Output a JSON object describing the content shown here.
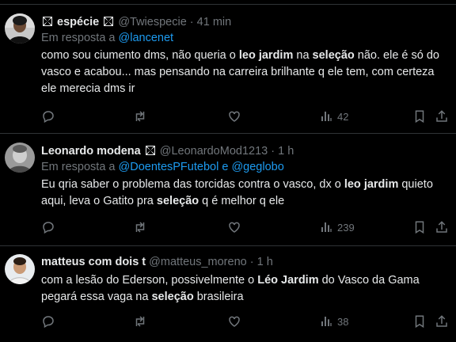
{
  "tweets": [
    {
      "display_name": "espécie",
      "handle": "@Twiespecie",
      "separator": "·",
      "time": "41 min",
      "reply_prefix": "Em resposta a",
      "reply_to": [
        "@lancenet"
      ],
      "reply_joiner": "",
      "text_segments": [
        {
          "t": "como sou ciumento dms, não queria o ",
          "b": false
        },
        {
          "t": "leo jardim",
          "b": true
        },
        {
          "t": " na ",
          "b": false
        },
        {
          "t": "seleção",
          "b": true
        },
        {
          "t": " não. ele é só do vasco e acabou... mas pensando na carreira brilhante q ele tem, com certeza ele merecia dms ir",
          "b": false
        }
      ],
      "views": "42",
      "icons": {
        "name_prefix": "maltese-cross-icon",
        "name_suffix": "maltese-cross-icon"
      }
    },
    {
      "display_name": "Leonardo modena",
      "handle": "@LeonardoMod1213",
      "separator": "·",
      "time": "1 h",
      "reply_prefix": "Em resposta a",
      "reply_to": [
        "@DoentesPFutebol",
        "@geglobo"
      ],
      "reply_joiner": "e",
      "text_segments": [
        {
          "t": "Eu qria saber o problema das torcidas contra o vasco, dx o ",
          "b": false
        },
        {
          "t": "leo jardim",
          "b": true
        },
        {
          "t": " quieto aqui, leva o Gatito pra ",
          "b": false
        },
        {
          "t": "seleção",
          "b": true
        },
        {
          "t": " q é melhor q ele",
          "b": false
        }
      ],
      "views": "239",
      "icons": {
        "name_suffix": "maltese-cross-icon"
      }
    },
    {
      "display_name": "matteus com dois t",
      "handle": "@matteus_moreno",
      "separator": "·",
      "time": "1 h",
      "reply_prefix": "",
      "reply_to": [],
      "reply_joiner": "",
      "text_segments": [
        {
          "t": "com a lesão do Ederson, possivelmente o ",
          "b": false
        },
        {
          "t": "Léo Jardim",
          "b": true
        },
        {
          "t": " do Vasco da Gama pegará essa vaga na ",
          "b": false
        },
        {
          "t": "seleção",
          "b": true
        },
        {
          "t": " brasileira",
          "b": false
        }
      ],
      "views": "38",
      "icons": {}
    }
  ],
  "action_icons": [
    "reply-icon",
    "retweet-icon",
    "like-icon",
    "views-icon",
    "bookmark-icon",
    "share-icon"
  ],
  "colors": {
    "background": "#000000",
    "text": "#e7e9ea",
    "secondary": "#71767b",
    "link": "#1d9bf0",
    "divider": "#2f3336"
  }
}
